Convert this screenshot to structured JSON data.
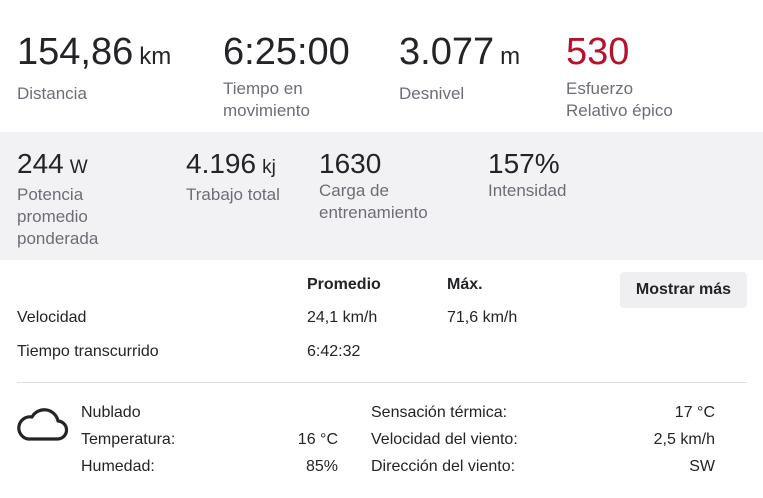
{
  "summary": {
    "distance": {
      "value": "154,86",
      "unit": "km",
      "label": "Distancia"
    },
    "moving_time": {
      "value": "6:25:00",
      "label_line1": "Tiempo en",
      "label_line2": "movimiento"
    },
    "elevation": {
      "value": "3.077",
      "unit": "m",
      "label": "Desnivel"
    },
    "relative_effort": {
      "value": "530",
      "label_line1": "Esfuerzo",
      "label_line2": "Relativo épico",
      "color": "#b4122d"
    }
  },
  "power": {
    "weighted_power": {
      "value": "244",
      "unit": "W",
      "label_line1": "Potencia",
      "label_line2": "promedio",
      "label_line3": "ponderada"
    },
    "total_work": {
      "value": "4.196",
      "unit": "kj",
      "label": "Trabajo total"
    },
    "training_load": {
      "value": "1630",
      "label_line1": "Carga de",
      "label_line2": "entrenamiento"
    },
    "intensity": {
      "value": "157%",
      "label": "Intensidad"
    }
  },
  "details": {
    "col_avg": "Promedio",
    "col_max": "Máx.",
    "show_more": "Mostrar más",
    "rows": [
      {
        "label": "Velocidad",
        "avg": "24,1 km/h",
        "max": "71,6 km/h"
      },
      {
        "label": "Tiempo transcurrido",
        "avg": "6:42:32",
        "max": ""
      }
    ]
  },
  "weather": {
    "icon": "cloud-icon",
    "condition": "Nublado",
    "left": [
      {
        "label": "Temperatura:",
        "value": "16 °C"
      },
      {
        "label": "Humedad:",
        "value": "85%"
      }
    ],
    "right": [
      {
        "label": "Sensación térmica:",
        "value": "17 °C"
      },
      {
        "label": "Velocidad del viento:",
        "value": "2,5 km/h"
      },
      {
        "label": "Dirección del viento:",
        "value": "SW"
      }
    ]
  }
}
